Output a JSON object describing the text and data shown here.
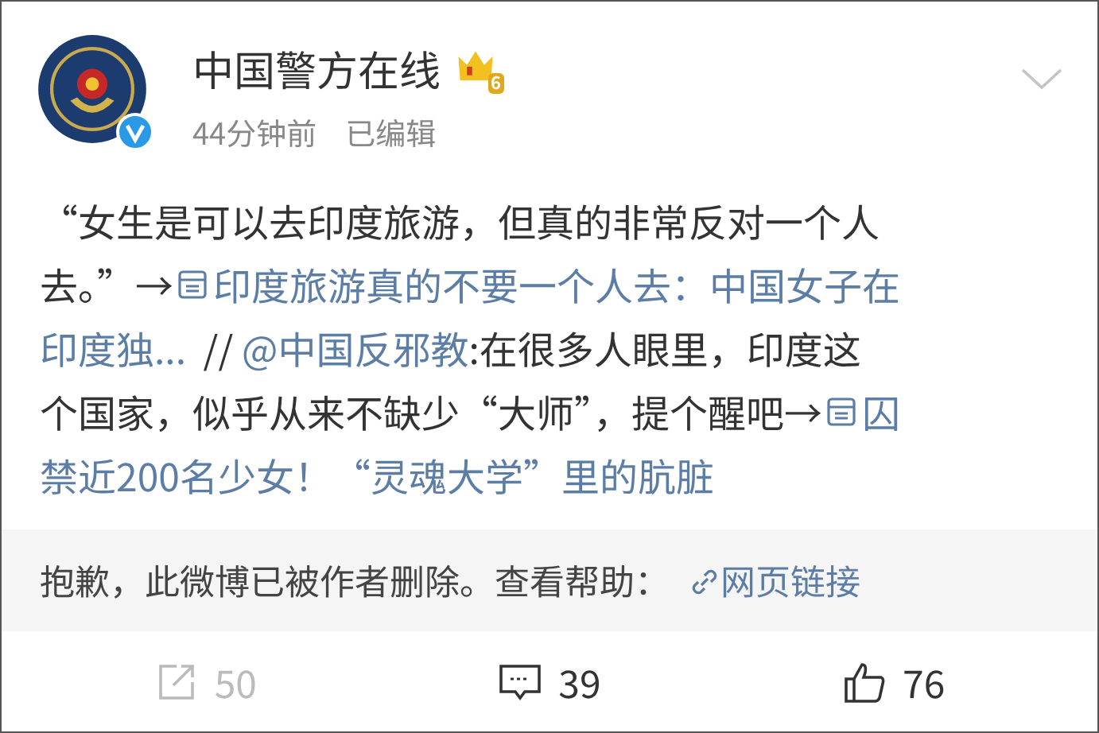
{
  "post": {
    "author": "中国警方在线",
    "level_badge": "6",
    "time": "44分钟前",
    "edited": "已编辑",
    "verified": true,
    "body": [
      [
        {
          "kind": "text",
          "text": "“女生是可以去印度旅游，但真的非常反对一个人"
        }
      ],
      [
        {
          "kind": "text",
          "text": "去。”→"
        },
        {
          "kind": "link",
          "text": "印度旅游真的不要一个人去：中国女子在"
        }
      ],
      [
        {
          "kind": "link_cont",
          "text": "印度独..."
        },
        {
          "kind": "text",
          "text": "  // "
        },
        {
          "kind": "mention",
          "text": "@中国反邪教"
        },
        {
          "kind": "text",
          "text": ":在很多人眼里，印度这"
        }
      ],
      [
        {
          "kind": "text",
          "text": "个国家，似乎从来不缺少“大师”，提个醒吧→"
        },
        {
          "kind": "link",
          "text": "囚"
        }
      ],
      [
        {
          "kind": "link_cont",
          "text": "禁近200名少女！“灵魂大学”里的肮脏"
        }
      ]
    ],
    "deleted_notice": {
      "text": "抱歉，此微博已被作者删除。查看帮助：",
      "link": "网页链接"
    },
    "actions": [
      {
        "kind": "repost",
        "count": "50",
        "disabled": true
      },
      {
        "kind": "comment",
        "count": "39",
        "disabled": false
      },
      {
        "kind": "like",
        "count": "76",
        "disabled": false
      }
    ]
  }
}
